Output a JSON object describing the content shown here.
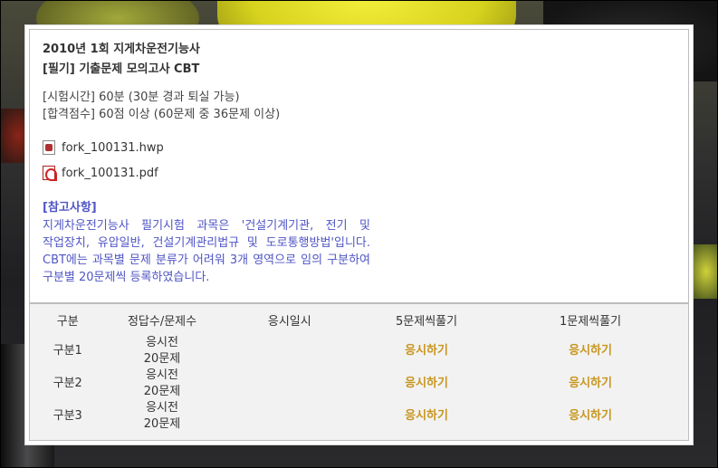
{
  "exam": {
    "title": "2010년 1회 지게차운전기능사",
    "subtitle": "[필기] 기출문제 모의고사 CBT",
    "time": "[시험시간] 60분 (30분 경과 퇴실 가능)",
    "pass": "[합격점수] 60점 이상 (60문제 중 36문제 이상)"
  },
  "files": [
    {
      "name": "fork_100131.hwp",
      "icon": "hwp-file-icon"
    },
    {
      "name": "fork_100131.pdf",
      "icon": "pdf-file-icon"
    }
  ],
  "notes": {
    "heading": "[참고사항]",
    "body": "지게차운전기능사 필기시험 과목은 '건설기계기관, 전기 및 작업장치, 유압일반, 건설기계관리법규 및 도로통행방법'입니다. CBT에는 과목별 문제 분류가 어려워 3개 영역으로 임의 구분하여 구분별 20문제씩 등록하였습니다."
  },
  "table": {
    "headers": [
      "구분",
      "정답수/문제수",
      "응시일시",
      "5문제씩풀기",
      "1문제씩풀기"
    ],
    "rows": [
      {
        "section": "구분1",
        "status": "응시전",
        "count": "20문제",
        "date": "",
        "five": "응시하기",
        "one": "응시하기"
      },
      {
        "section": "구분2",
        "status": "응시전",
        "count": "20문제",
        "date": "",
        "five": "응시하기",
        "one": "응시하기"
      },
      {
        "section": "구분3",
        "status": "응시전",
        "count": "20문제",
        "date": "",
        "five": "응시하기",
        "one": "응시하기"
      }
    ]
  },
  "colors": {
    "accent_blue": "#4f55c5",
    "link_gold": "#c8961e",
    "table_bg": "#f2f2f2"
  }
}
